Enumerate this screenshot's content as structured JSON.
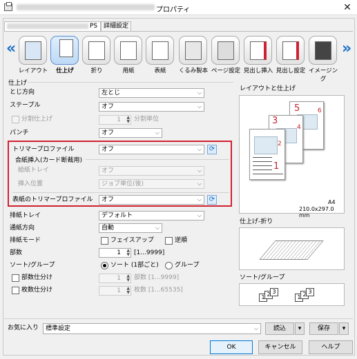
{
  "window": {
    "title": "プロパティ",
    "close": "✕"
  },
  "tabs": {
    "ps": "PS",
    "advanced": "詳細設定"
  },
  "ribbon": {
    "left_arrow": "«",
    "right_arrow": "»",
    "items": [
      {
        "label": "レイアウト",
        "icon": "layout-icon"
      },
      {
        "label": "仕上げ",
        "icon": "finishing-icon",
        "selected": true
      },
      {
        "label": "折り",
        "icon": "fold-icon"
      },
      {
        "label": "用紙",
        "icon": "paper-icon"
      },
      {
        "label": "表紙",
        "icon": "cover-icon"
      },
      {
        "label": "くるみ製本",
        "icon": "perfect-binding-icon"
      },
      {
        "label": "ページ設定",
        "icon": "page-setting-icon"
      },
      {
        "label": "見出し挿入",
        "icon": "tab-insert-icon"
      },
      {
        "label": "見出し設定",
        "icon": "tab-setting-icon"
      },
      {
        "label": "イメージング",
        "icon": "imaging-icon"
      }
    ]
  },
  "finishing": {
    "group": "仕上げ",
    "binding_direction": {
      "label": "とじ方向",
      "value": "左とじ"
    },
    "staple": {
      "label": "ステープル",
      "value": "オフ"
    },
    "split_finishing": {
      "label": "分割仕上げ",
      "value": "1",
      "unit": "分割単位"
    },
    "punch": {
      "label": "パンチ",
      "value": "オフ"
    },
    "trimmer_profile": {
      "label": "トリマープロファイル",
      "value": "オフ"
    },
    "sheet_insert": {
      "group": "合紙挿入(カード断裁用)",
      "tray": {
        "label": "給紙トレイ",
        "value": "オフ"
      },
      "position": {
        "label": "挿入位置",
        "value": "ジョブ単位(後)"
      }
    },
    "cover_trimmer_profile": {
      "label": "表紙のトリマープロファイル",
      "value": "オフ"
    },
    "output_tray": {
      "label": "排紙トレイ",
      "value": "デフォルト"
    },
    "output_direction": {
      "label": "通紙方向",
      "value": "自動"
    },
    "output_mode": {
      "label": "排紙モード",
      "face_up": "フェイスアップ",
      "reverse": "逆順"
    },
    "copies": {
      "label": "部数",
      "value": "1",
      "range": "[1...9999]"
    },
    "sort_group": {
      "label": "ソート/グループ",
      "sort": "ソート (1部ごと)",
      "group": "グループ"
    },
    "copy_split": {
      "label": "部数仕分け",
      "value": "1",
      "unit": "部数 [1...9999]"
    },
    "sheet_split": {
      "label": "枚数仕分け",
      "value": "1",
      "unit": "枚数 [1...65535]"
    }
  },
  "preview": {
    "layout_title": "レイアウトと仕上げ",
    "page_numbers": [
      "1",
      "2",
      "3",
      "4",
      "5",
      "6"
    ],
    "paper_name": "A4",
    "paper_size": "210.0x297.0 mm",
    "fold_title": "仕上げ-折り",
    "sort_title": "ソート/グループ",
    "sort_glyphs": [
      "1",
      "2",
      "3",
      "1",
      "2",
      "3"
    ]
  },
  "footer": {
    "favorites_label": "お気に入り",
    "favorites_value": "標準設定",
    "load": "読込",
    "save": "保存",
    "ok": "OK",
    "cancel": "キャンセル",
    "help": "ヘルプ"
  }
}
